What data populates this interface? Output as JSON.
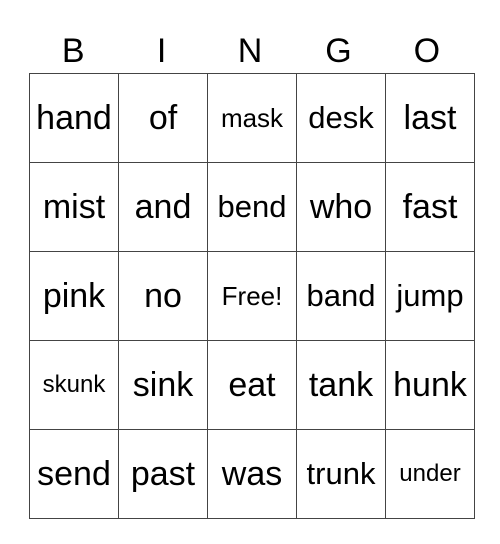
{
  "title_letters": [
    "B",
    "I",
    "N",
    "G",
    "O"
  ],
  "rows": [
    [
      "hand",
      "of",
      "mask",
      "desk",
      "last"
    ],
    [
      "mist",
      "and",
      "bend",
      "who",
      "fast"
    ],
    [
      "pink",
      "no",
      "Free!",
      "band",
      "jump"
    ],
    [
      "skunk",
      "sink",
      "eat",
      "tank",
      "hunk"
    ],
    [
      "send",
      "past",
      "was",
      "trunk",
      "under"
    ]
  ]
}
